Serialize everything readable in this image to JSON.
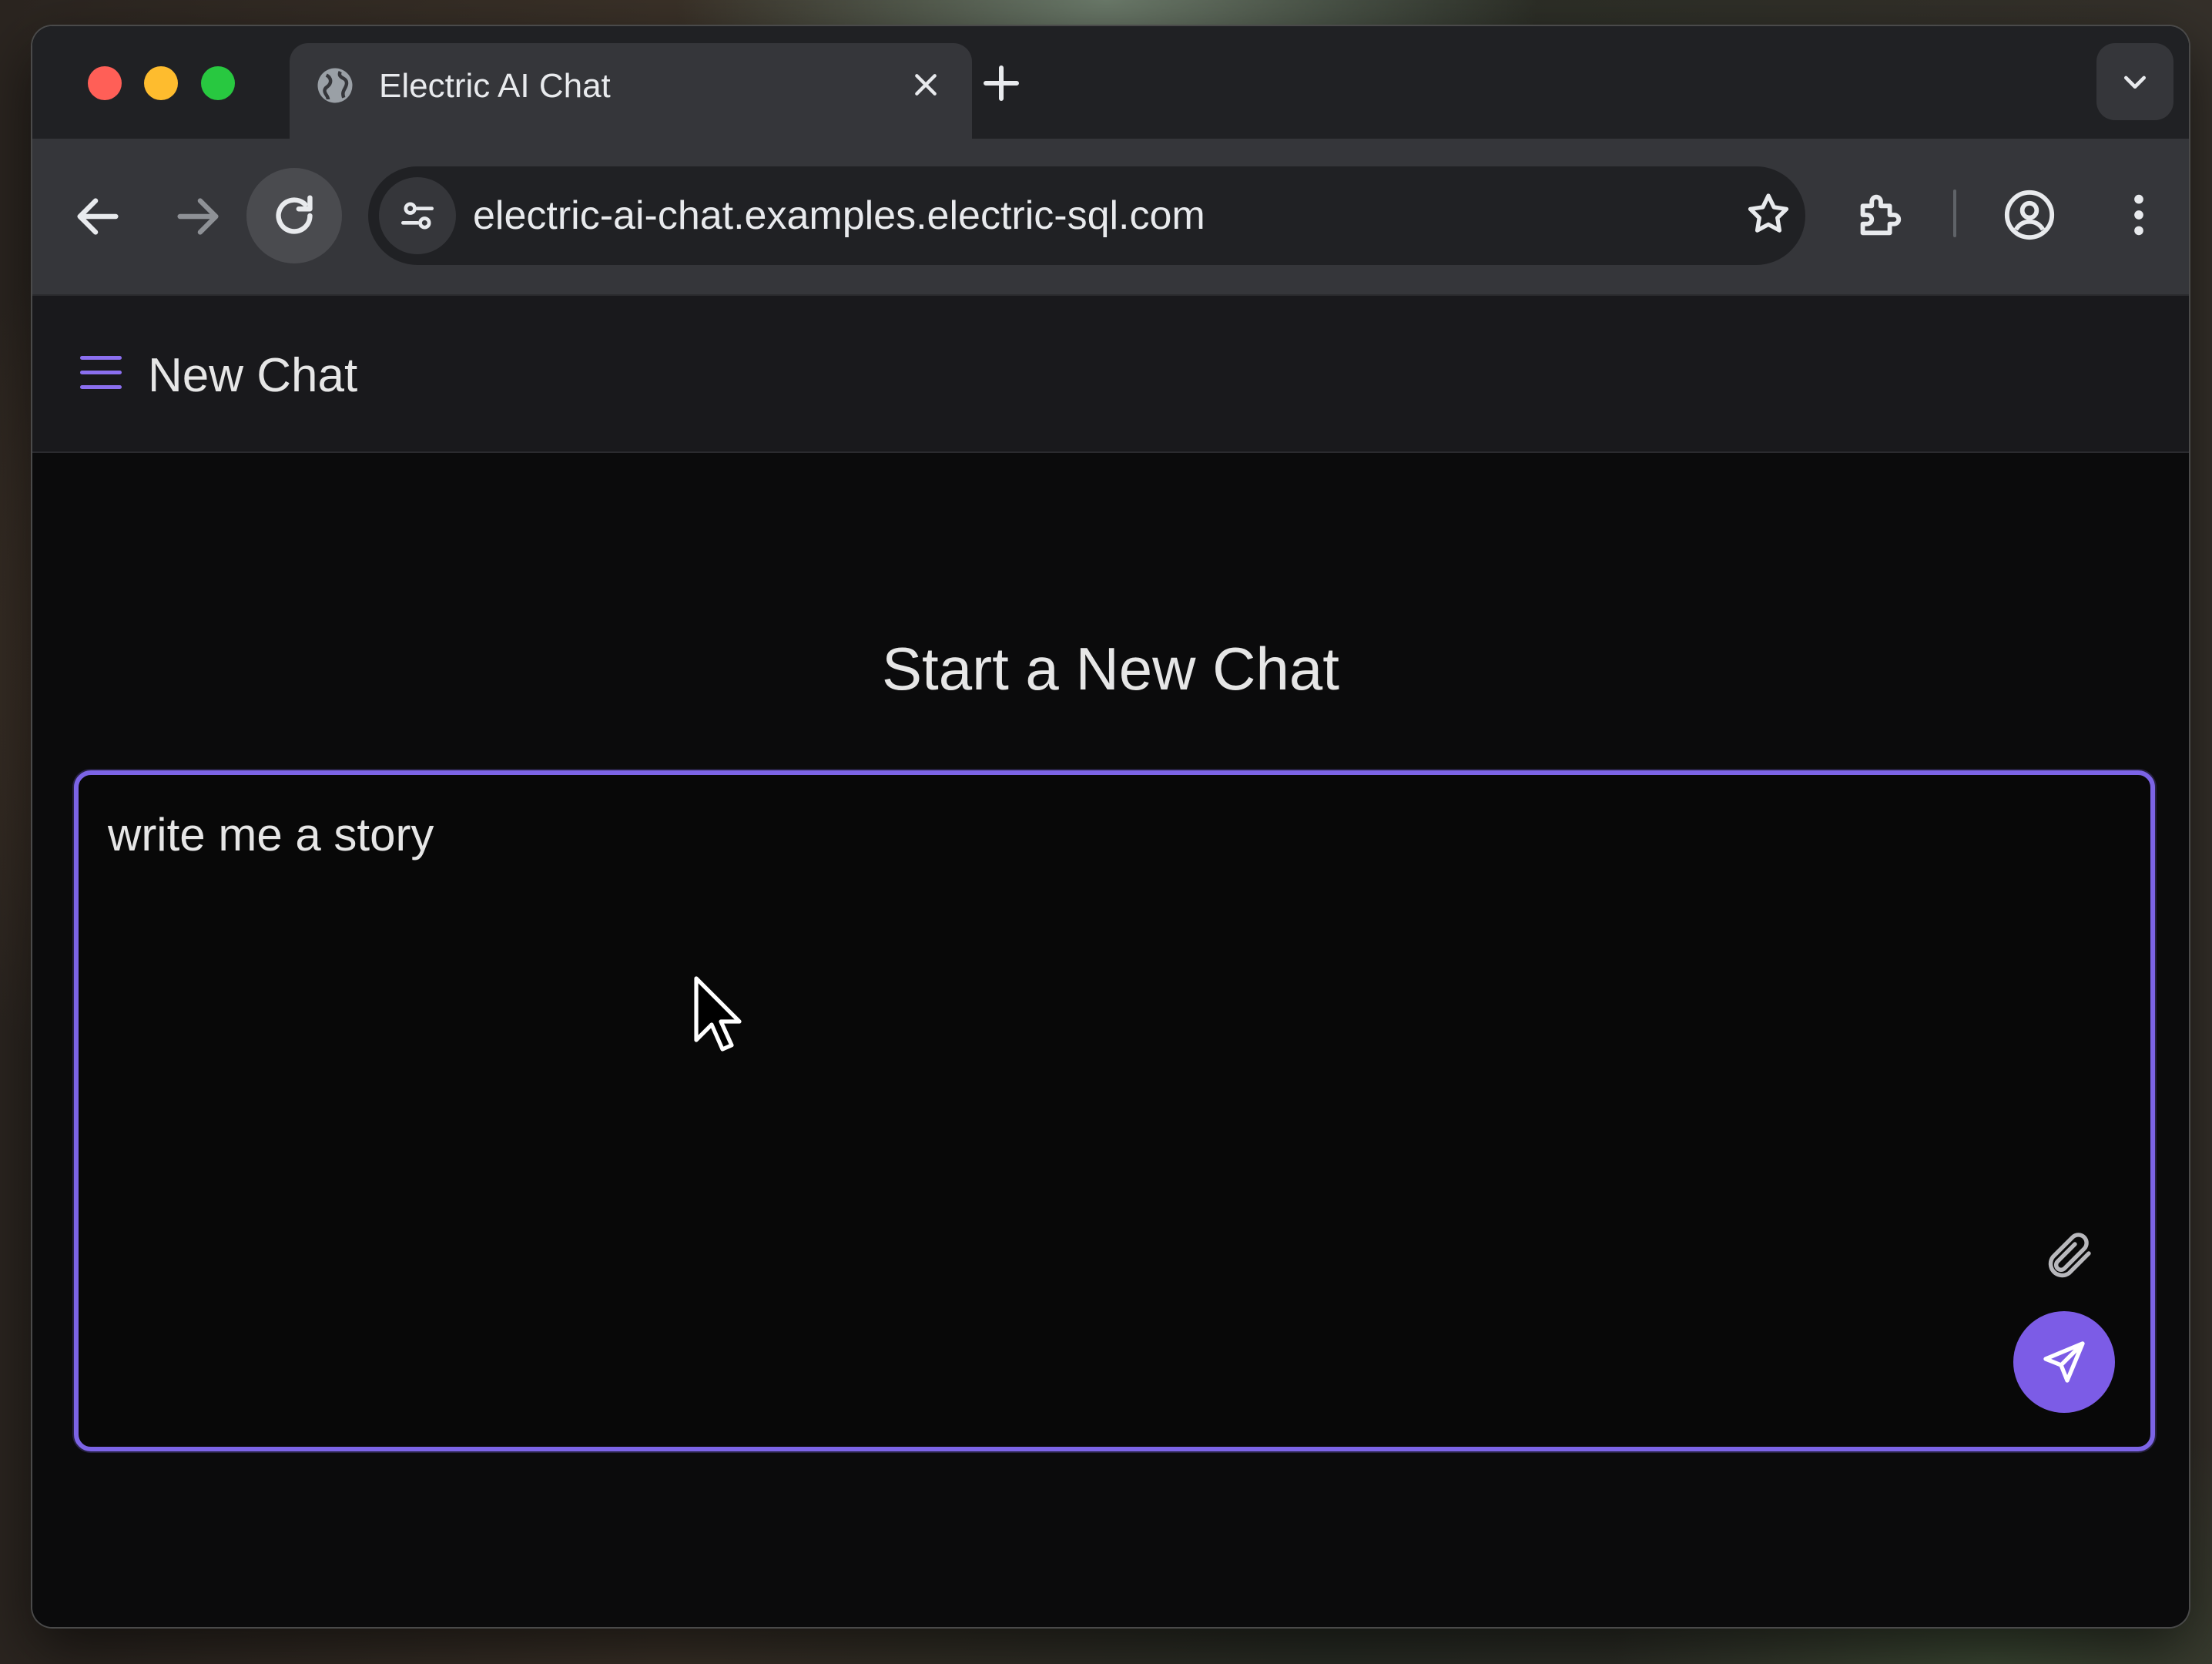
{
  "browser": {
    "tab": {
      "title": "Electric AI Chat",
      "favicon": "globe-icon"
    },
    "url": "electric-ai-chat.examples.electric-sql.com",
    "icons": {
      "back": "back-arrow-icon",
      "forward": "forward-arrow-icon",
      "reload": "reload-icon",
      "site_settings": "tune-icon",
      "bookmark": "star-icon",
      "extensions": "puzzle-icon",
      "profile": "account-circle-icon",
      "menu": "more-vert-icon",
      "tab_search": "chevron-down-icon"
    }
  },
  "app": {
    "header": {
      "title": "New Chat"
    },
    "main": {
      "heading": "Start a New Chat",
      "composer": {
        "value": "write me a story"
      }
    },
    "colors": {
      "accent": "#7c5ce6",
      "border": "#7c64e6",
      "background": "#0b0b0c"
    }
  }
}
